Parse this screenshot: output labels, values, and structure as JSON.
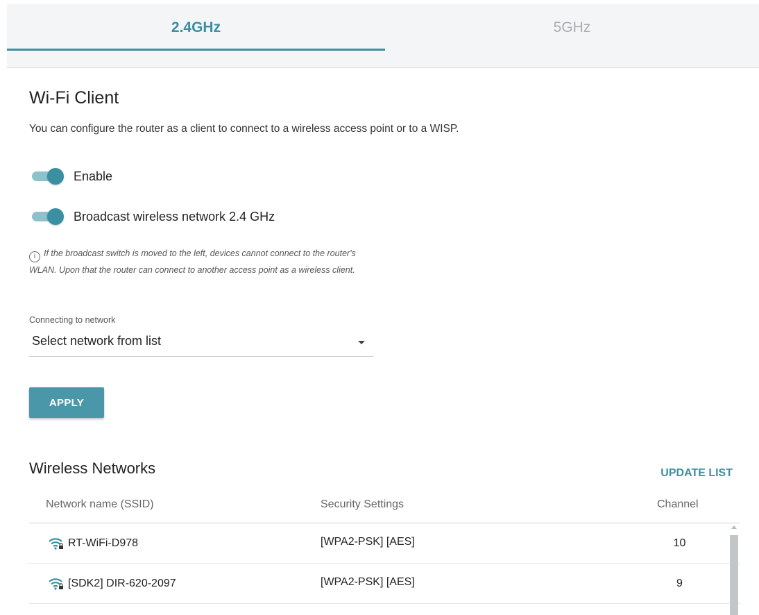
{
  "tabs": [
    {
      "label": "2.4GHz",
      "active": true
    },
    {
      "label": "5GHz",
      "active": false
    }
  ],
  "page": {
    "title": "Wi-Fi Client",
    "description": "You can configure the router as a client to connect to a wireless access point or to a WISP."
  },
  "toggles": {
    "enable": {
      "label": "Enable",
      "on": true
    },
    "broadcast": {
      "label": "Broadcast wireless network 2.4 GHz",
      "on": true
    }
  },
  "note": {
    "icon": "info-icon",
    "text": "If the broadcast switch is moved to the left, devices cannot connect to the router's WLAN. Upon that the router can connect to another access point as a wireless client."
  },
  "network_select": {
    "label": "Connecting to network",
    "value": "Select network from list"
  },
  "apply_label": "APPLY",
  "wireless": {
    "title": "Wireless Networks",
    "update_label": "UPDATE LIST",
    "columns": [
      "Network name (SSID)",
      "Security Settings",
      "Channel"
    ],
    "rows": [
      {
        "ssid": "RT-WiFi-D978",
        "security": "[WPA2-PSK] [AES]",
        "channel": "10",
        "icon": "wifi-lock-icon"
      },
      {
        "ssid": "[SDK2] DIR-620-2097",
        "security": "[WPA2-PSK] [AES]",
        "channel": "9",
        "icon": "wifi-lock-icon"
      }
    ]
  },
  "colors": {
    "accent": "#3a8fa3",
    "button": "#4a97a9",
    "toggle_track": "#8ec1cc",
    "tab_bar": "#f4f5f6"
  }
}
